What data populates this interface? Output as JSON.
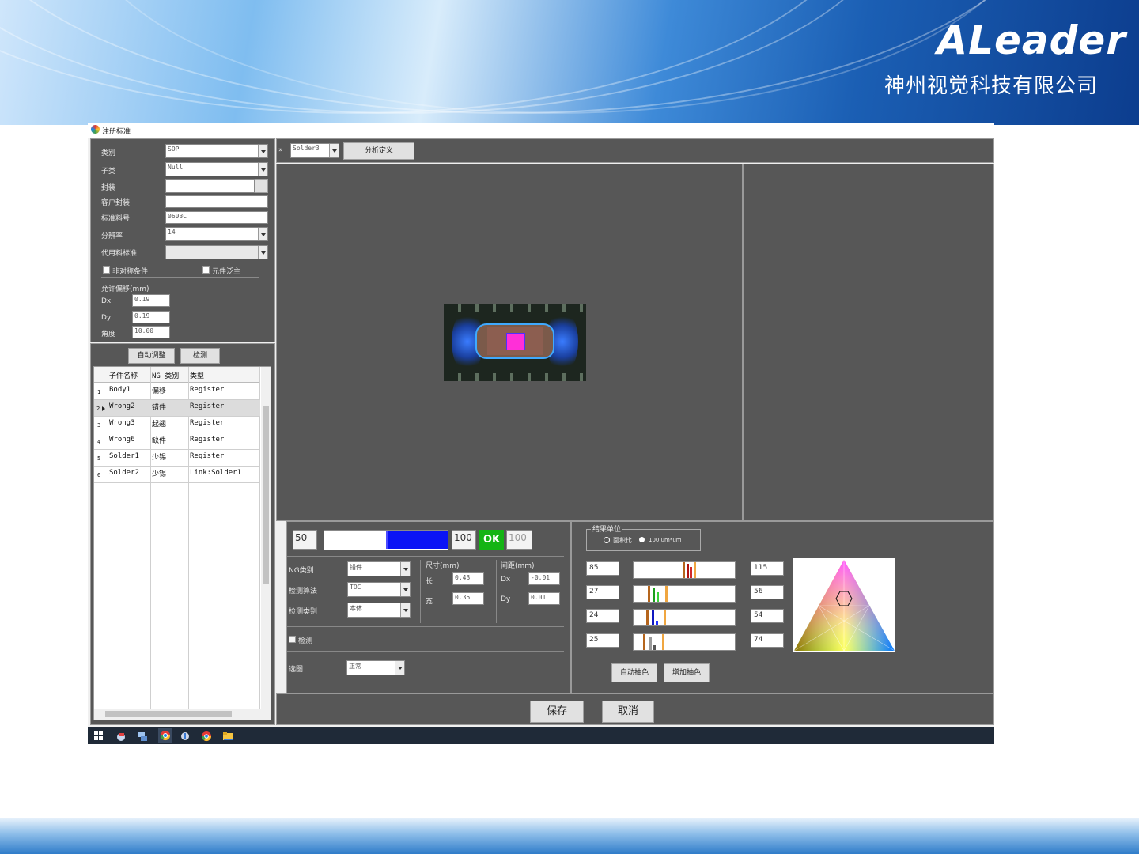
{
  "brand": {
    "name": "ALeader",
    "subtitle": "神州视觉科技有限公司"
  },
  "window": {
    "title": "注册标准"
  },
  "form": {
    "category_label": "类别",
    "category_value": "SOP",
    "subtype_label": "子类",
    "subtype_value": "Null",
    "package_label": "封装",
    "package_value": "",
    "package_browse": "...",
    "customer_package_label": "客户封装",
    "customer_package_value": "",
    "std_part_label": "标准料号",
    "std_part_value": "0603C",
    "resolution_label": "分辨率",
    "resolution_value": "14",
    "alt_std_label": "代用料标准",
    "alt_std_value": "",
    "asym_label": "非对称条件",
    "component_color_label": "元件泛主",
    "offset_title": "允许偏移(mm)",
    "dx_label": "Dx",
    "dx_value": "0.19",
    "dy_label": "Dy",
    "dy_value": "0.19",
    "angle_label": "角度",
    "angle_value": "10.00"
  },
  "grid_toolbar": {
    "auto_adjust": "自动调整",
    "detect": "检测"
  },
  "grid": {
    "headers": [
      "子件名称",
      "NG 类别",
      "类型"
    ],
    "rows": [
      {
        "idx": "1",
        "name": "Body1",
        "ng": "偏移",
        "type": "Register"
      },
      {
        "idx": "2",
        "name": "Wrong2",
        "ng": "错件",
        "type": "Register"
      },
      {
        "idx": "3",
        "name": "Wrong3",
        "ng": "起翘",
        "type": "Register"
      },
      {
        "idx": "4",
        "name": "Wrong6",
        "ng": "缺件",
        "type": "Register"
      },
      {
        "idx": "5",
        "name": "Solder1",
        "ng": "少锡",
        "type": "Register"
      },
      {
        "idx": "6",
        "name": "Solder2",
        "ng": "少锡",
        "type": "Link:Solder1"
      }
    ]
  },
  "top_toolbar": {
    "expand": "»",
    "solder_select": "Solder3",
    "analysis_button": "分析定义"
  },
  "threshold": {
    "low": "50",
    "high": "100",
    "status": "OK",
    "status_value": "100"
  },
  "ng_panel": {
    "ng_type_label": "NG类别",
    "ng_type_value": "错件",
    "algo_label": "检测算法",
    "algo_value": "TOC",
    "detect_type_label": "检测类别",
    "detect_type_value": "本体",
    "size_title": "尺寸(mm)",
    "len_label": "长",
    "len_value": "0.43",
    "wid_label": "宽",
    "wid_value": "0.35",
    "gap_title": "间距(mm)",
    "gdx_label": "Dx",
    "gdx_value": "-0.01",
    "gdy_label": "Dy",
    "gdy_value": "0.01",
    "check_label": "检测",
    "select_image_label": "选图",
    "select_image_value": "正常"
  },
  "color_panel": {
    "result_unit_title": "结果单位",
    "opt_area": "面积比",
    "opt_um": "100 um*um",
    "rows": [
      {
        "min": "85",
        "max": "115"
      },
      {
        "min": "27",
        "max": "56"
      },
      {
        "min": "24",
        "max": "54"
      },
      {
        "min": "25",
        "max": "74"
      }
    ],
    "auto_color": "自动抽色",
    "add_color": "增加抽色"
  },
  "actions": {
    "save": "保存",
    "cancel": "取消"
  },
  "taskbar_icons": [
    "windows-start-icon",
    "app-icon",
    "network-icon",
    "chrome-icon",
    "tool-icon",
    "chrome-icon",
    "folder-icon"
  ]
}
